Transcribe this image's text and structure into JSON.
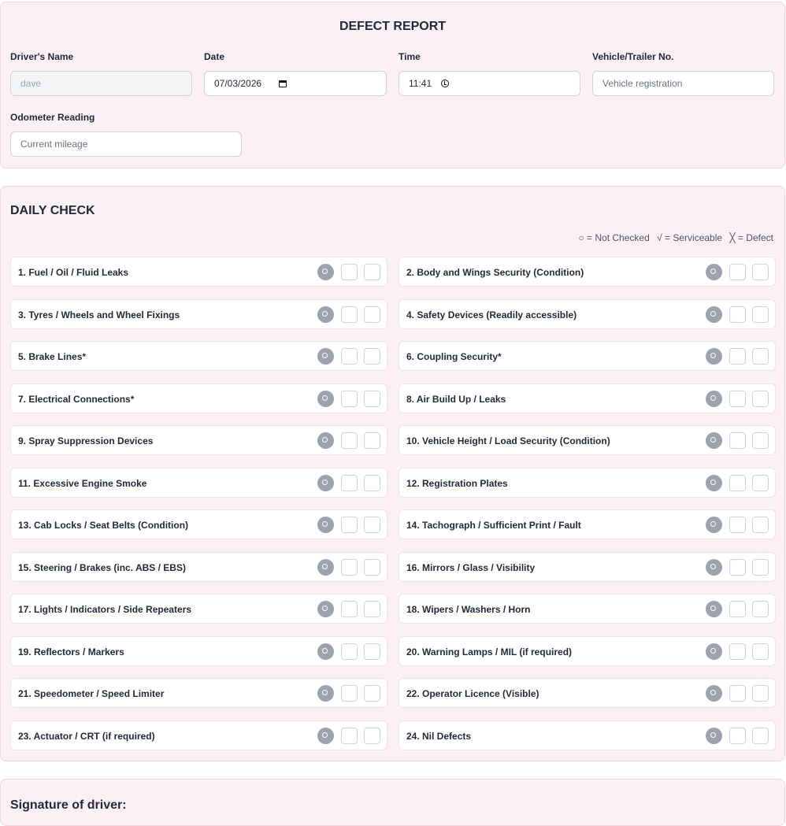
{
  "report": {
    "title": "DEFECT REPORT",
    "driver_name": {
      "label": "Driver's Name",
      "value": "dave"
    },
    "date": {
      "label": "Date",
      "value": "07/03/2026"
    },
    "time": {
      "label": "Time",
      "value": "11:41"
    },
    "vehicle": {
      "label": "Vehicle/Trailer No.",
      "placeholder": "Vehicle registration"
    },
    "odometer": {
      "label": "Odometer Reading",
      "placeholder": "Current mileage"
    }
  },
  "daily_check": {
    "title": "DAILY CHECK",
    "legend": {
      "not_checked": "○ = Not Checked",
      "serviceable": "√ = Serviceable",
      "defect": "╳ = Defect"
    },
    "items": [
      "1. Fuel / Oil / Fluid Leaks",
      "2. Body and Wings Security (Condition)",
      "3. Tyres / Wheels and Wheel Fixings",
      "4. Safety Devices (Readily accessible)",
      "5. Brake Lines*",
      "6. Coupling Security*",
      "7. Electrical Connections*",
      "8. Air Build Up / Leaks",
      "9. Spray Suppression Devices",
      "10. Vehicle Height / Load Security (Condition)",
      "11. Excessive Engine Smoke",
      "12. Registration Plates",
      "13. Cab Locks / Seat Belts (Condition)",
      "14. Tachograph / Sufficient Print / Fault",
      "15. Steering / Brakes (inc. ABS / EBS)",
      "16. Mirrors / Glass / Visibility",
      "17. Lights / Indicators / Side Repeaters",
      "18. Wipers / Washers / Horn",
      "19. Reflectors / Markers",
      "20. Warning Lamps / MIL (if required)",
      "21. Speedometer / Speed Limiter",
      "22. Operator Licence (Visible)",
      "23. Actuator / CRT (if required)",
      "24. Nil Defects"
    ]
  },
  "signature": {
    "title": "Signature of driver:"
  }
}
